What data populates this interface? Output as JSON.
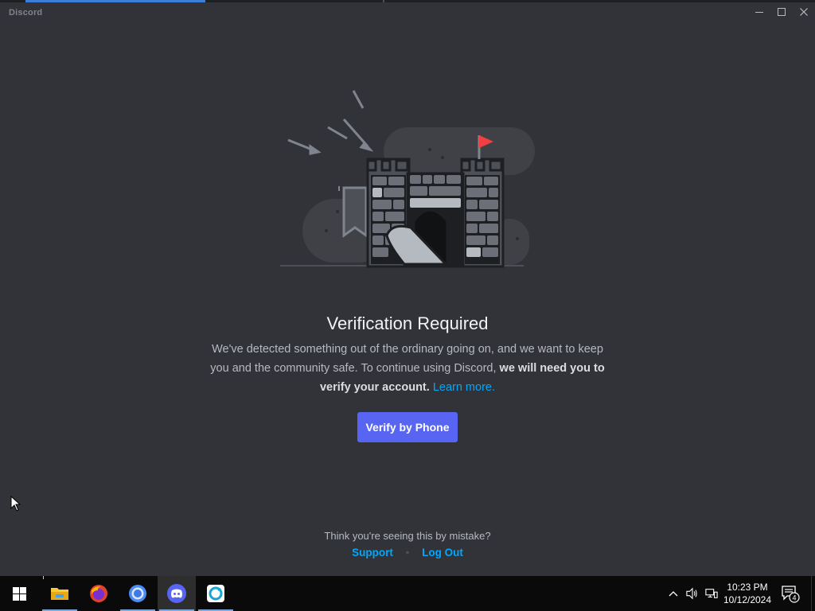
{
  "window": {
    "app_title": "Discord",
    "controls": {
      "minimize": "minimize-icon",
      "maximize": "maximize-icon",
      "close": "close-icon"
    }
  },
  "illustration": {
    "name": "castle-illustration",
    "accent_color": "#f23f42"
  },
  "verification": {
    "title": "Verification Required",
    "description_plain": "We've detected something out of the ordinary going on, and we want to keep you and the community safe. To continue using Discord,",
    "description_bold": "we will need you to verify your account.",
    "learn_more": "Learn more.",
    "button_label": "Verify by Phone"
  },
  "footer": {
    "question": "Think you're seeing this by mistake?",
    "support": "Support",
    "separator": "•",
    "logout": "Log Out"
  },
  "taskbar": {
    "apps": [
      {
        "name": "File Explorer",
        "icon": "folder-icon"
      },
      {
        "name": "Firefox",
        "icon": "firefox-icon"
      },
      {
        "name": "Chrome",
        "icon": "chrome-icon"
      },
      {
        "name": "Discord",
        "icon": "discord-icon"
      },
      {
        "name": "Sync app",
        "icon": "sync-app-icon"
      }
    ],
    "clock_time": "10:23 PM",
    "clock_date": "10/12/2024",
    "notification_count": "4"
  },
  "colors": {
    "background": "#313338",
    "primary_button": "#5865f2",
    "link": "#00a8fc",
    "title_text": "#f2f3f5",
    "body_text": "#b5bac1"
  }
}
